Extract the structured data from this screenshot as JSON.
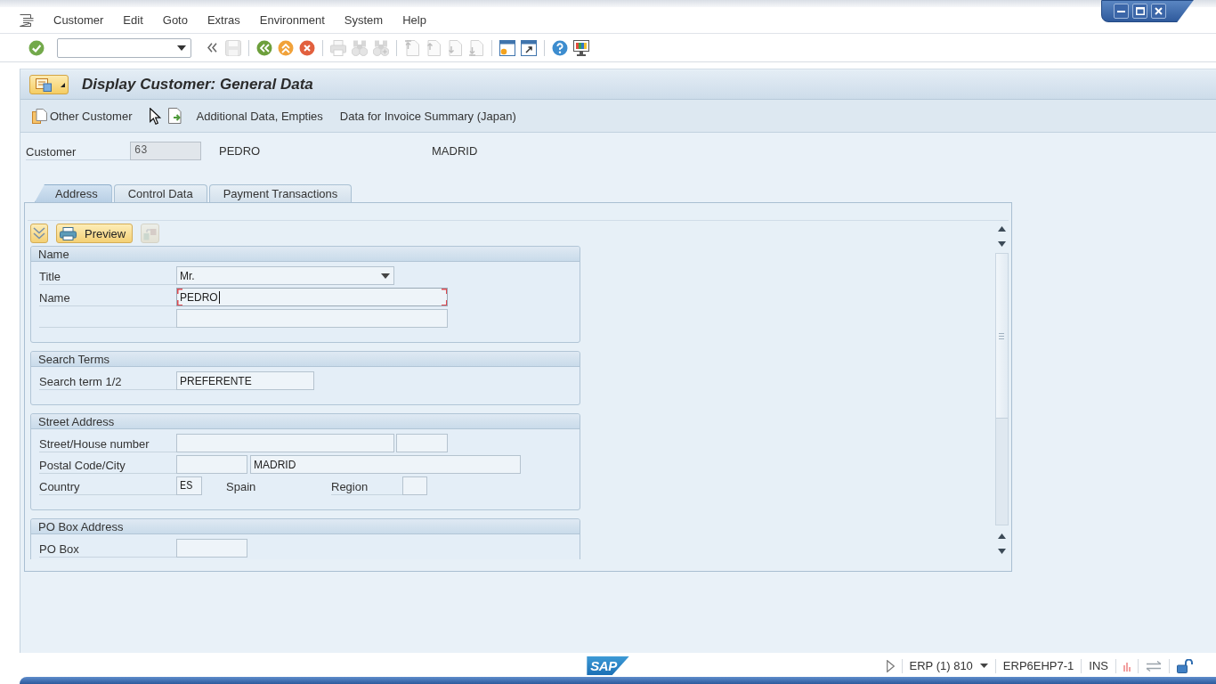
{
  "menu_bar": [
    "Customer",
    "Edit",
    "Goto",
    "Extras",
    "Environment",
    "System",
    "Help"
  ],
  "toolbar": {
    "groups": [
      [
        {
          "kind": "enter",
          "disabled": false
        },
        {
          "kind": "command_field",
          "disabled": false
        },
        {
          "kind": "collapse",
          "disabled": false
        },
        {
          "kind": "save",
          "disabled": true
        }
      ],
      [
        {
          "kind": "back",
          "disabled": false
        },
        {
          "kind": "exit",
          "disabled": false
        },
        {
          "kind": "cancel",
          "disabled": false
        }
      ],
      [
        {
          "kind": "print",
          "disabled": true
        },
        {
          "kind": "find",
          "disabled": true
        },
        {
          "kind": "find_next",
          "disabled": true
        }
      ],
      [
        {
          "kind": "first_page",
          "disabled": true
        },
        {
          "kind": "previous_page",
          "disabled": true
        },
        {
          "kind": "next_page",
          "disabled": true
        },
        {
          "kind": "last_page",
          "disabled": true
        }
      ],
      [
        {
          "kind": "new_session",
          "disabled": false
        },
        {
          "kind": "shortcut",
          "disabled": false
        }
      ],
      [
        {
          "kind": "help",
          "disabled": false
        },
        {
          "kind": "layout",
          "disabled": false
        }
      ]
    ]
  },
  "screen": {
    "title": "Display Customer: General Data"
  },
  "app_toolbar": [
    {
      "kind": "other_customer",
      "label": "Other Customer"
    },
    {
      "kind": "cursor"
    },
    {
      "kind": "document"
    },
    {
      "kind": "text",
      "label": "Additional Data, Empties"
    },
    {
      "kind": "text",
      "label": "Data for Invoice Summary (Japan)"
    }
  ],
  "customer": {
    "label": "Customer",
    "number": "63",
    "name": "PEDRO",
    "city": "MADRID"
  },
  "tabs": [
    {
      "label": "Address",
      "selected": true
    },
    {
      "label": "Control Data",
      "selected": false
    },
    {
      "label": "Payment Transactions",
      "selected": false
    }
  ],
  "subscreen_toolbar": [
    {
      "kind": "expand",
      "disabled": false
    },
    {
      "kind": "preview",
      "label": "Preview",
      "disabled": false
    },
    {
      "kind": "map",
      "disabled": true
    }
  ],
  "groups": [
    {
      "title": "Name",
      "rows": [
        {
          "label": "Title",
          "fields": [
            {
              "kind": "title",
              "value": "Mr.",
              "focused": false
            }
          ]
        },
        {
          "label": "Name",
          "fields": [
            {
              "kind": "name",
              "value": "PEDRO",
              "focused": true
            }
          ]
        },
        {
          "fields": [
            {
              "kind": "name",
              "focused": false
            }
          ]
        }
      ]
    },
    {
      "title": "Search Terms",
      "rows": [
        {
          "label": "Search term 1/2",
          "fields": [
            {
              "kind": "search_term",
              "value": "PREFERENTE",
              "focused": false
            }
          ]
        }
      ]
    },
    {
      "title": "Street Address",
      "rows": [
        {
          "label": "Street/House number",
          "fields": [
            {
              "kind": "street",
              "focused": false
            },
            {
              "kind": "house_number",
              "focused": false
            }
          ]
        },
        {
          "label": "Postal Code/City",
          "fields": [
            {
              "kind": "postal_code",
              "focused": false
            },
            {
              "kind": "city",
              "value": "MADRID",
              "focused": false
            }
          ]
        },
        {
          "label": "Country",
          "fields": [
            {
              "kind": "country",
              "value": "ES",
              "focused": false
            },
            {
              "kind": "description",
              "value": "Spain",
              "focused": false
            },
            {
              "kind": "label",
              "value": "Region",
              "focused": false
            },
            {
              "kind": "region",
              "focused": false
            }
          ]
        }
      ]
    },
    {
      "title": "PO Box Address",
      "rows": [
        {
          "label": "PO Box",
          "fields": [
            {
              "kind": "po_box",
              "focused": false
            }
          ]
        }
      ]
    }
  ],
  "status_bar": {
    "logo": "SAP",
    "system": "ERP (1) 810",
    "server": "ERP6EHP7-1",
    "mode": "INS"
  }
}
